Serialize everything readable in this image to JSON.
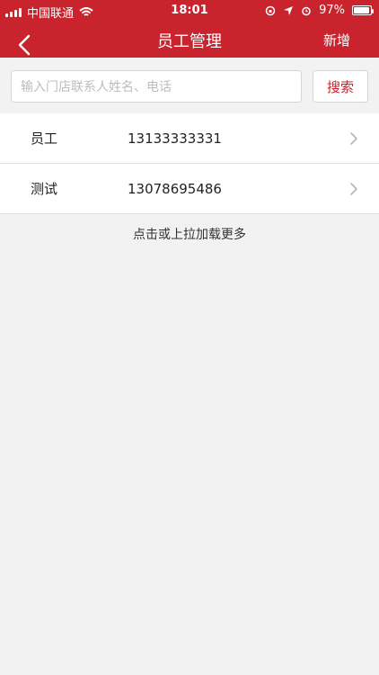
{
  "status_bar": {
    "carrier": "中国联通",
    "time": "18:01",
    "battery": "97%"
  },
  "navbar": {
    "title": "员工管理",
    "add_label": "新增"
  },
  "search": {
    "placeholder": "输入门店联系人姓名、电话",
    "button_label": "搜索"
  },
  "employees": [
    {
      "name": "员工",
      "phone": "13133333331"
    },
    {
      "name": "测试",
      "phone": "13078695486"
    }
  ],
  "footer": {
    "load_more": "点击或上拉加载更多"
  },
  "colors": {
    "brand": "#c9232d"
  }
}
